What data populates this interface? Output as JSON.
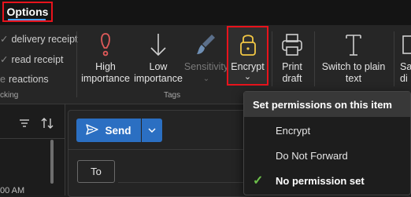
{
  "tabs": {
    "options_label": "Options"
  },
  "tracking": {
    "items": [
      "delivery receipt",
      "read receipt",
      "reactions"
    ],
    "group_label": "cking"
  },
  "ribbon": {
    "high_importance": [
      "High",
      "importance"
    ],
    "low_importance": [
      "Low",
      "importance"
    ],
    "sensitivity": "Sensitivity",
    "encrypt": "Encrypt",
    "print_draft": [
      "Print",
      "draft"
    ],
    "switch_plain": [
      "Switch to plain",
      "text"
    ],
    "partial": [
      "Sa",
      "di"
    ],
    "tags_label": "Tags"
  },
  "compose": {
    "send_label": "Send",
    "to_label": "To",
    "time_partial": "00 AM"
  },
  "permissions_menu": {
    "header": "Set permissions on this item",
    "items": [
      "Encrypt",
      "Do Not Forward",
      "No permission set"
    ],
    "checked_index": 2
  },
  "colors": {
    "highlight_border": "#e8131c",
    "send_blue": "#2b6fc2",
    "check_green": "#6cc04a",
    "lock_gold": "#f2c744"
  }
}
